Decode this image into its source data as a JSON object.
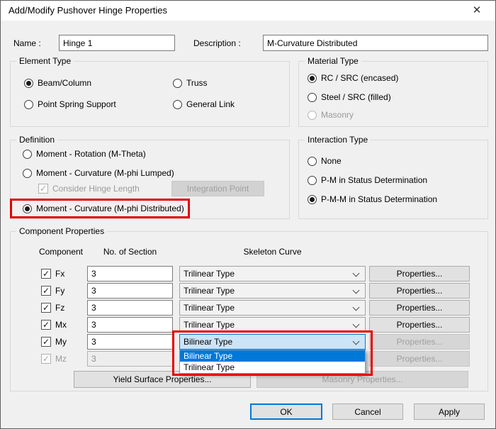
{
  "window": {
    "title": "Add/Modify Pushover Hinge Properties"
  },
  "icons": {
    "close": "✕",
    "check": "✓"
  },
  "header": {
    "name_label": "Name :",
    "name_value": "Hinge 1",
    "description_label": "Description :",
    "description_value": "M-Curvature Distributed"
  },
  "groups": {
    "element_type": {
      "title": "Element Type",
      "options": [
        {
          "label": "Beam/Column",
          "selected": true
        },
        {
          "label": "Truss",
          "selected": false
        },
        {
          "label": "Point Spring Support",
          "selected": false
        },
        {
          "label": "General Link",
          "selected": false
        }
      ]
    },
    "material_type": {
      "title": "Material Type",
      "options": [
        {
          "label": "RC / SRC (encased)",
          "selected": true
        },
        {
          "label": "Steel / SRC (filled)",
          "selected": false
        },
        {
          "label": "Masonry",
          "selected": false,
          "disabled": true
        }
      ]
    },
    "definition": {
      "title": "Definition",
      "options": [
        {
          "label": "Moment - Rotation (M-Theta)",
          "selected": false
        },
        {
          "label": "Moment - Curvature (M-phi Lumped)",
          "selected": false
        },
        {
          "label": "Moment - Curvature (M-phi Distributed)",
          "selected": true,
          "highlighted": true
        }
      ],
      "consider_hinge_length_label": "Consider Hinge Length",
      "consider_hinge_length_checked": true,
      "consider_hinge_length_disabled": true,
      "integration_point_label": "Integration Point",
      "integration_point_disabled": true
    },
    "interaction_type": {
      "title": "Interaction Type",
      "options": [
        {
          "label": "None",
          "selected": false
        },
        {
          "label": "P-M in Status Determination",
          "selected": false
        },
        {
          "label": "P-M-M in Status Determination",
          "selected": true
        }
      ]
    }
  },
  "component_properties": {
    "title": "Component Properties",
    "columns": {
      "component": "Component",
      "sections": "No. of Section",
      "skeleton": "Skeleton Curve"
    },
    "properties_label": "Properties...",
    "rows": [
      {
        "name": "Fx",
        "checked": true,
        "disabled": false,
        "sections": "3",
        "skeleton": "Trilinear Type",
        "properties_disabled": false
      },
      {
        "name": "Fy",
        "checked": true,
        "disabled": false,
        "sections": "3",
        "skeleton": "Trilinear Type",
        "properties_disabled": false
      },
      {
        "name": "Fz",
        "checked": true,
        "disabled": false,
        "sections": "3",
        "skeleton": "Trilinear Type",
        "properties_disabled": false
      },
      {
        "name": "Mx",
        "checked": true,
        "disabled": false,
        "sections": "3",
        "skeleton": "Trilinear Type",
        "properties_disabled": false
      },
      {
        "name": "My",
        "checked": true,
        "disabled": false,
        "sections": "3",
        "skeleton": "Bilinear Type",
        "combo_open": true,
        "properties_disabled": true
      },
      {
        "name": "Mz",
        "checked": true,
        "disabled": true,
        "sections": "3",
        "properties_disabled": true
      }
    ],
    "dropdown": {
      "options": [
        {
          "label": "Bilinear Type",
          "highlighted": true
        },
        {
          "label": "Trilinear Type",
          "highlighted": false
        }
      ]
    },
    "yield_surface_label": "Yield Surface Properties...",
    "masonry_label": "Masonry Properties...",
    "masonry_disabled": true
  },
  "footer": {
    "ok_label": "OK",
    "cancel_label": "Cancel",
    "apply_label": "Apply"
  },
  "colors": {
    "accent_blue": "#0078d7",
    "highlight_red": "#e60000",
    "combo_focus_bg": "#cce4f7"
  }
}
